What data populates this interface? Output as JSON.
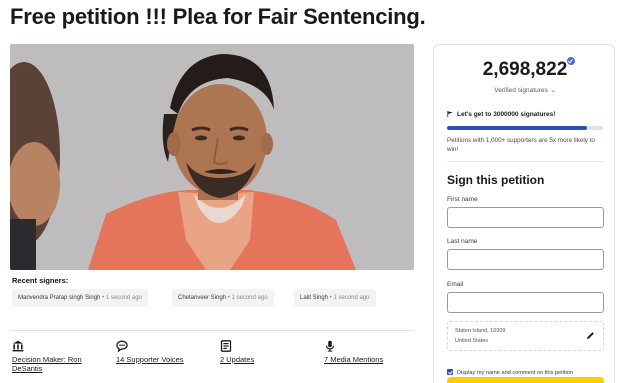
{
  "page": {
    "title": "Free petition !!! Plea for Fair Sentencing."
  },
  "recent_signers": {
    "label": "Recent signers:",
    "items": [
      {
        "name": "Manvendra Pratap singh Singh",
        "time": "1 second ago"
      },
      {
        "name": "Chetanveer Singh",
        "time": "1 second ago"
      },
      {
        "name": "Lalit Singh",
        "time": "1 second ago"
      }
    ]
  },
  "stats": [
    {
      "label": "Decision Maker: Ron DeSantis",
      "icon": "bank-building-icon"
    },
    {
      "label": "14 Supporter Voices",
      "icon": "speech-bubble-icon"
    },
    {
      "label": "2 Updates",
      "icon": "updates-doc-icon"
    },
    {
      "label": "7 Media Mentions",
      "icon": "microphone-icon"
    }
  ],
  "signature_panel": {
    "count": "2,698,822",
    "verified_label": "Verified signatures",
    "goal_text": "Let's get to 3000000 signatures!",
    "progress_fraction": 0.8996,
    "tip": "Petitions with 1,000+ supporters are 5x more likely to win!"
  },
  "form": {
    "title": "Sign this petition",
    "first_name_label": "First name",
    "last_name_label": "Last name",
    "email_label": "Email",
    "location_city": "Staten Island, 10309",
    "location_country": "United States",
    "consent_text": "Display my name and comment on this petition"
  },
  "colors": {
    "accent_blue": "#2f4eb8",
    "sign_button_yellow": "#ffcc00",
    "jumpsuit_orange": "#e4755a"
  }
}
